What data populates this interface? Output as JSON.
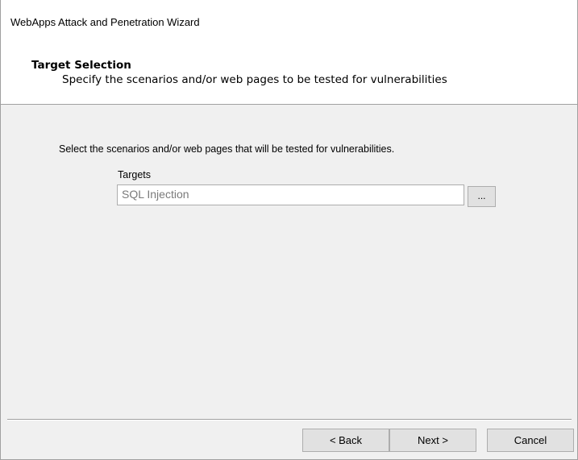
{
  "window": {
    "title": "WebApps Attack and Penetration Wizard"
  },
  "header": {
    "heading": "Target Selection",
    "subheading": "Specify the scenarios and/or web pages to be tested for vulnerabilities"
  },
  "main": {
    "instruction": "Select the scenarios and/or web pages that will be tested for vulnerabilities.",
    "targets": {
      "label": "Targets",
      "value": "SQL Injection",
      "browse_label": "..."
    }
  },
  "footer": {
    "back_label": "< Back",
    "next_label": "Next >",
    "cancel_label": "Cancel"
  },
  "colors": {
    "dialog_background": "#f0f0f0",
    "header_background": "#ffffff",
    "button_face": "#e1e1e1",
    "disabled_text": "#7a7a7a"
  }
}
